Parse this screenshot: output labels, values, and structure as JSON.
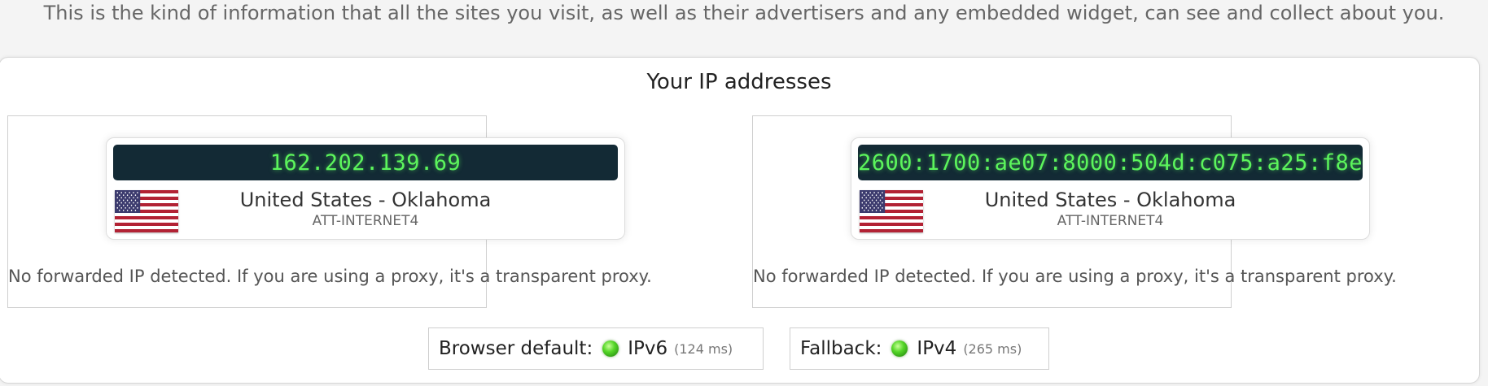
{
  "intro_text": "This is the kind of information that all the sites you visit, as well as their advertisers and any embedded widget, can see and collect about you.",
  "section_title": "Your IP addresses",
  "ipv4_panel": {
    "ip": "162.202.139.69",
    "location": "United States - Oklahoma",
    "isp": "ATT-INTERNET4",
    "forwarded_note": "No forwarded IP detected. If you are using a proxy, it's a transparent proxy."
  },
  "ipv6_panel": {
    "ip": "2600:1700:ae07:8000:504d:c075:a25:f8e",
    "location": "United States - Oklahoma",
    "isp": "ATT-INTERNET4",
    "forwarded_note": "No forwarded IP detected. If you are using a proxy, it's a transparent proxy."
  },
  "browser_default": {
    "label": "Browser default:",
    "protocol": "IPv6",
    "latency": "(124 ms)",
    "status_color": "#55d628"
  },
  "fallback": {
    "label": "Fallback:",
    "protocol": "IPv4",
    "latency": "(265 ms)",
    "status_color": "#55d628"
  },
  "icons": {
    "flag": "us-flag-icon",
    "status": "green-status-dot-icon"
  },
  "colors": {
    "ip_display_bg": "#132a35",
    "ip_display_text": "#5cf55c"
  }
}
